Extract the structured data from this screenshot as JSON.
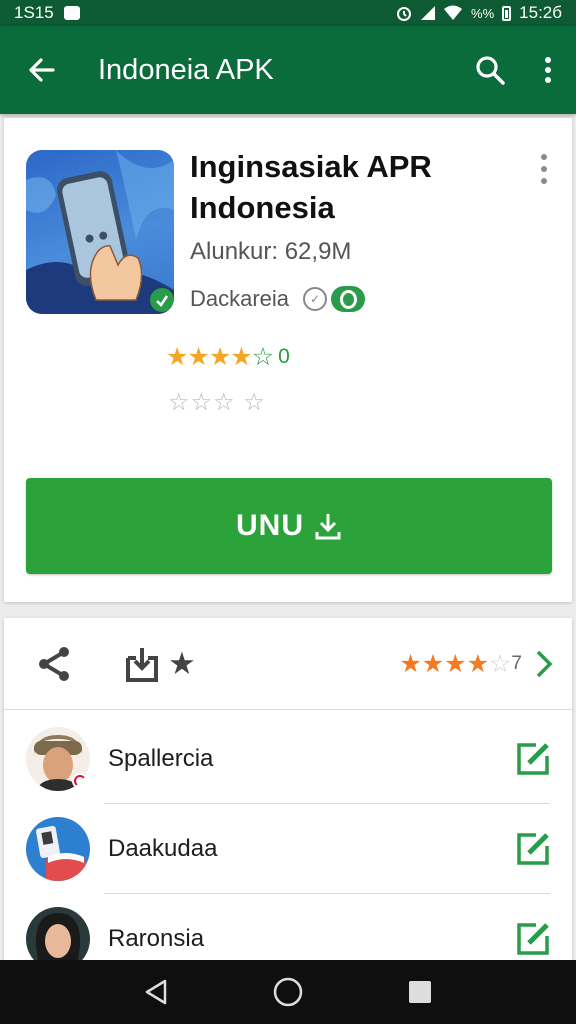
{
  "status_bar": {
    "time_left": "1S15",
    "battery_text": "%%",
    "time_right": "15:2б"
  },
  "app_bar": {
    "title": "Indoneia APK",
    "icons": [
      "back-arrow-icon",
      "search-icon",
      "more-vert-icon"
    ]
  },
  "app_card": {
    "title": "Inginsasiak APR Indonesia",
    "size": "Alunkur: 62,9M",
    "developer": "Dackareia",
    "rating_suffix": "0",
    "install_label": "UNU",
    "accent_color": "#2ca33a",
    "star_color": "#f6a623"
  },
  "actions": {
    "rating_count": "7"
  },
  "users": [
    {
      "name": "Spallercia"
    },
    {
      "name": "Daakudaa"
    },
    {
      "name": "Raronsia"
    }
  ],
  "nav": {
    "icons": [
      "back-triangle-icon",
      "home-circle-icon",
      "recents-square-icon"
    ]
  }
}
